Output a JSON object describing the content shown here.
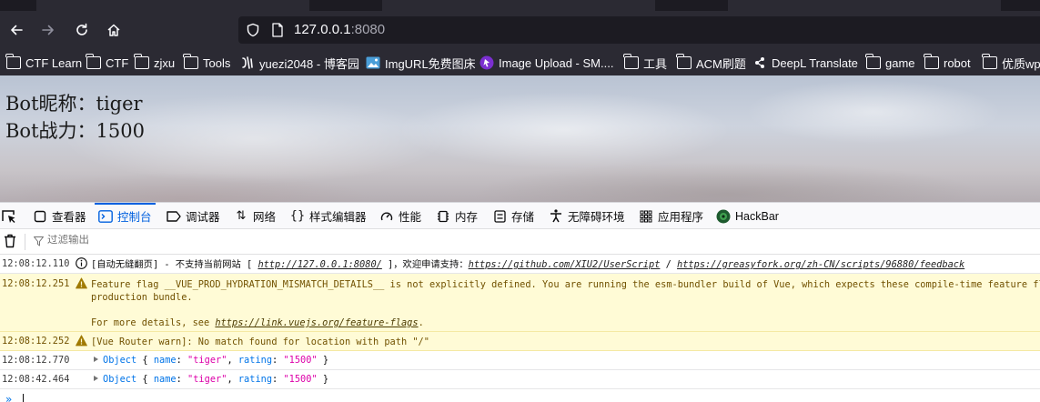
{
  "browser": {
    "url_host": "127.0.0.1",
    "url_port": ":8080",
    "bookmarks": [
      {
        "label": "CTF Learn",
        "icon": "folder-icon"
      },
      {
        "label": "CTF",
        "icon": "folder-icon"
      },
      {
        "label": "zjxu",
        "icon": "folder-icon"
      },
      {
        "label": "Tools",
        "icon": "folder-icon"
      },
      {
        "label": "yuezi2048 - 博客园",
        "icon": "cnblogs-icon"
      },
      {
        "label": "ImgURL免费图床",
        "icon": "image-icon"
      },
      {
        "label": "Image Upload - SM....",
        "icon": "smms-icon"
      },
      {
        "label": "工具",
        "icon": "folder-icon"
      },
      {
        "label": "ACM刷题",
        "icon": "folder-icon"
      },
      {
        "label": "DeepL Translate",
        "icon": "deepl-icon"
      },
      {
        "label": "game",
        "icon": "folder-icon"
      },
      {
        "label": "robot",
        "icon": "folder-icon"
      },
      {
        "label": "优质wp",
        "icon": "folder-icon"
      }
    ]
  },
  "page": {
    "bot_name_line": "Bot昵称：tiger",
    "bot_rating_line": "Bot战力：1500"
  },
  "devtools": {
    "tabs": [
      {
        "label": "查看器",
        "icon": "inspector-icon"
      },
      {
        "label": "控制台",
        "icon": "console-icon"
      },
      {
        "label": "调试器",
        "icon": "debugger-icon"
      },
      {
        "label": "网络",
        "icon": "network-icon"
      },
      {
        "label": "样式编辑器",
        "icon": "style-editor-icon"
      },
      {
        "label": "性能",
        "icon": "performance-icon"
      },
      {
        "label": "内存",
        "icon": "memory-icon"
      },
      {
        "label": "存储",
        "icon": "storage-icon"
      },
      {
        "label": "无障碍环境",
        "icon": "accessibility-icon"
      },
      {
        "label": "应用程序",
        "icon": "application-icon"
      },
      {
        "label": "HackBar",
        "icon": "hackbar-icon"
      }
    ],
    "selected_tab": "控制台",
    "filter_placeholder": "过滤输出",
    "messages": [
      {
        "time": "12:08:12.110",
        "level": "info",
        "prefix": "[自动无缝翻页] - 不支持当前网站 [ ",
        "link1": "http://127.0.0.1:8080/",
        "middle": " ]，欢迎申请支持：",
        "link2": "https://github.com/XIU2/UserScript",
        "sep": " / ",
        "link3": "https://greasyfork.org/zh-CN/scripts/96880/feedback"
      },
      {
        "time": "12:08:12.251",
        "level": "warning",
        "line1": "Feature flag __VUE_PROD_HYDRATION_MISMATCH_DETAILS__ is not explicitly defined. You are running the esm-bundler build of Vue, which expects these compile-time feature flags t",
        "line2": "production bundle.",
        "line3_prefix": "For more details, see ",
        "line3_link": "https://link.vuejs.org/feature-flags",
        "line3_suffix": "."
      },
      {
        "time": "12:08:12.252",
        "level": "warning",
        "text": "[Vue Router warn]: No match found for location with path \"/\""
      },
      {
        "time": "12:08:12.770",
        "level": "log",
        "object_kw": "Object",
        "name_key": "name",
        "name_val": "\"tiger\"",
        "rating_key": "rating",
        "rating_val": "\"1500\""
      },
      {
        "time": "12:08:42.464",
        "level": "log",
        "object_kw": "Object",
        "name_key": "name",
        "name_val": "\"tiger\"",
        "rating_key": "rating",
        "rating_val": "\"1500\""
      }
    ],
    "prompt_symbol": "»"
  }
}
